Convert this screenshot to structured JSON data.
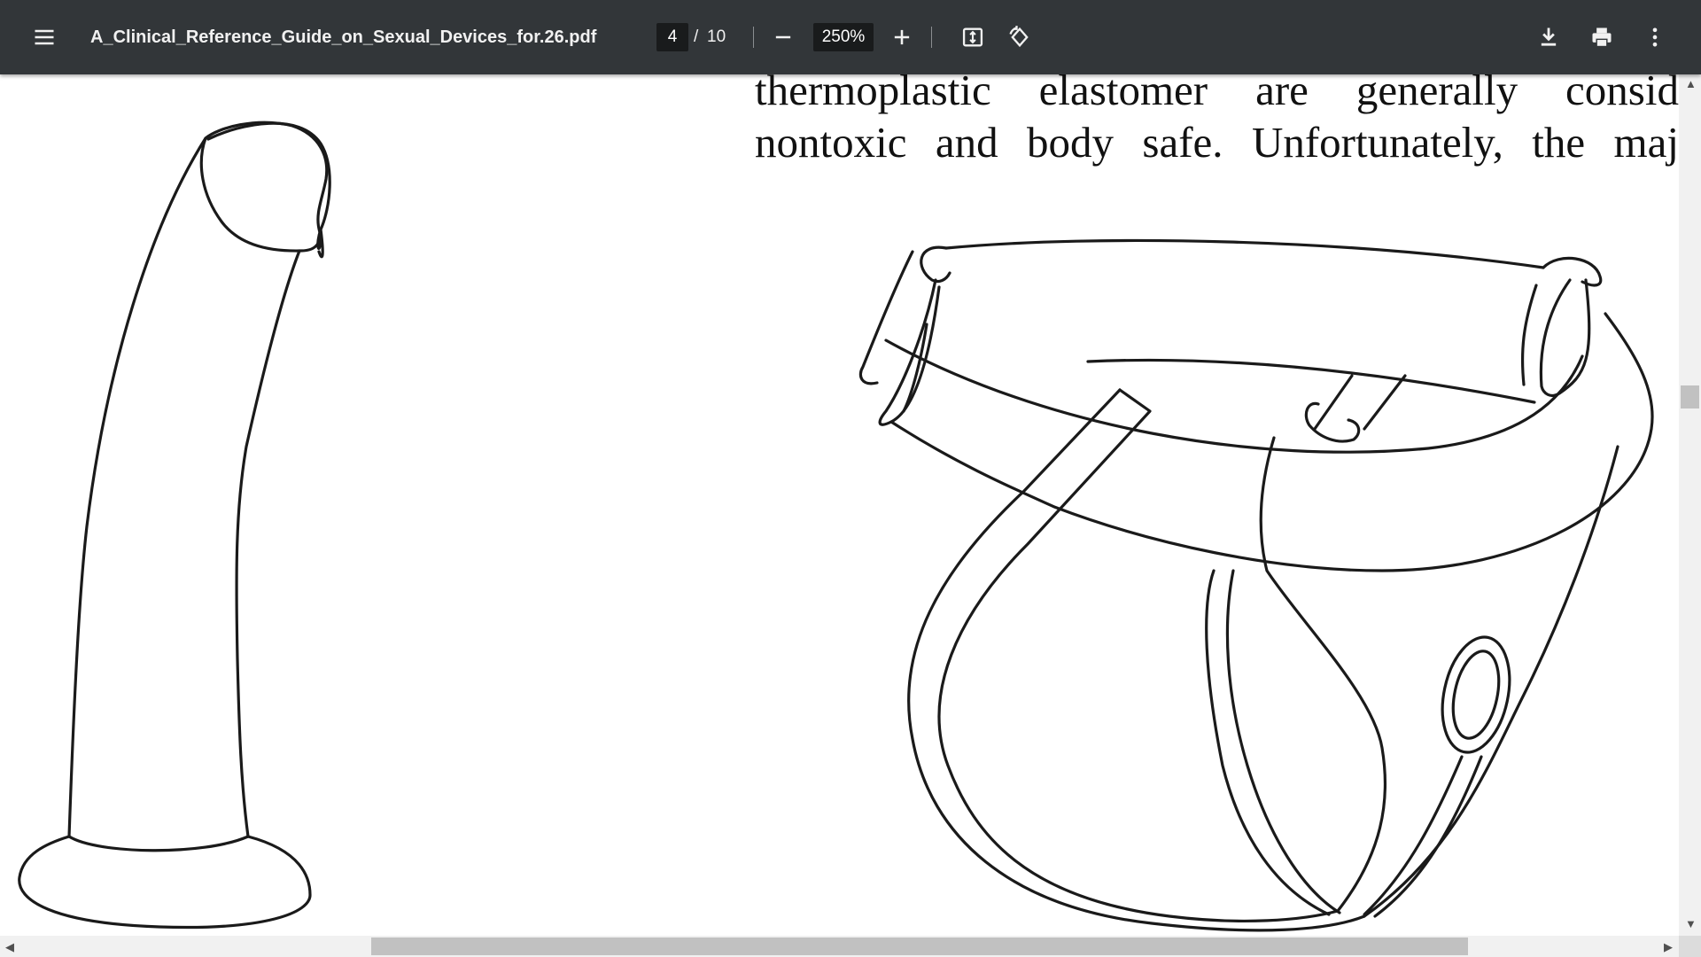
{
  "toolbar": {
    "menu_icon": "hamburger-menu-icon",
    "title": "A_Clinical_Reference_Guide_on_Sexual_Devices_for.26.pdf",
    "page_current": "4",
    "page_separator": "/",
    "page_total": "10",
    "zoom_out_icon": "minus-icon",
    "zoom_value": "250%",
    "zoom_in_icon": "plus-icon",
    "fit_icon": "fit-to-page-icon",
    "rotate_icon": "rotate-counterclockwise-icon",
    "download_icon": "download-icon",
    "print_icon": "print-icon",
    "more_icon": "more-vertical-icon"
  },
  "document": {
    "line1": "thermoplastic elastomer are generally consid",
    "line2": "nontoxic and body safe. Unfortunately, the maj",
    "figures": [
      "dildo-illustration",
      "harness-illustration"
    ]
  },
  "colors": {
    "toolbar_bg": "#323639",
    "toolbar_text": "#f1f1f1",
    "input_bg": "#191b1c",
    "page_bg": "#ffffff",
    "scrollbar_track": "#f1f1f1",
    "scrollbar_thumb": "#c1c1c1"
  }
}
